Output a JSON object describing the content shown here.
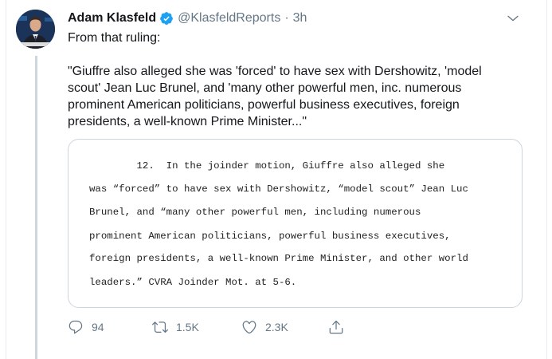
{
  "tweet": {
    "author_name": "Adam Klasfeld",
    "handle": "@KlasfeldReports",
    "separator": "·",
    "time": "3h",
    "intro": "From that ruling:",
    "body_lines": [
      "\"Giuffre also alleged she was 'forced' to have sex with Dershowitz, 'model",
      "scout' Jean Luc Brunel, and 'many other powerful men, inc. numerous",
      "prominent American politicians, powerful business executives, foreign",
      "presidents, a well-known Prime Minister...\""
    ],
    "document_lines": [
      "        12.  In the joinder motion, Giuffre also alleged she",
      "was “forced” to have sex with Dershowitz, “model scout” Jean Luc",
      "Brunel, and “many other powerful men, including numerous",
      "prominent American politicians, powerful business executives,",
      "foreign presidents, a well-known Prime Minister, and other world",
      "leaders.” CVRA Joinder Mot. at 5-6."
    ]
  },
  "actions": {
    "reply_count": "94",
    "retweet_count": "1.5K",
    "like_count": "2.3K"
  },
  "icons": {
    "verified": "verified-badge-icon",
    "menu": "chevron-down-icon",
    "reply": "reply-icon",
    "retweet": "retweet-icon",
    "like": "heart-icon",
    "share": "share-icon"
  },
  "colors": {
    "accent": "#1da1f2",
    "secondary_text": "#657786",
    "thread_line": "#ccd6dd"
  }
}
